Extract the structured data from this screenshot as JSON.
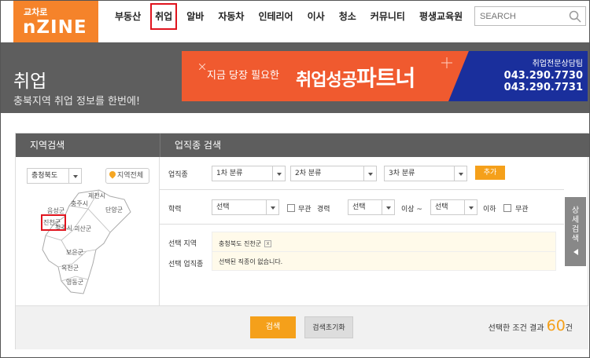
{
  "header": {
    "logo_small": "교차로",
    "logo_big": "nZINE",
    "nav": [
      "부동산",
      "취업",
      "알바",
      "자동차",
      "인테리어",
      "이사",
      "청소",
      "커뮤니티",
      "평생교육원"
    ],
    "active_nav": "취업",
    "search_placeholder": "SEARCH"
  },
  "banner": {
    "title": "취업",
    "subtitle": "충북지역 취업 정보를 한번에!",
    "promo_left": "지금 당장 필요한",
    "promo_main_prefix": "취업성공",
    "promo_main_big": "파트너",
    "promo_consult": "취업전문상담팀",
    "promo_phone1": "043.290.7730",
    "promo_phone2": "043.290.7731"
  },
  "region": {
    "header": "지역검색",
    "province": "충청북도",
    "all_button": "지역전체",
    "map_labels": [
      "제천시",
      "충주시",
      "음성군",
      "단양군",
      "진천군",
      "청주시",
      "괴산군",
      "보은군",
      "옥천군",
      "영동군"
    ]
  },
  "job": {
    "header": "업직종 검색",
    "category_label": "업직종",
    "cat1": "1차 분류",
    "cat2": "2차 분류",
    "cat3": "3차 분류",
    "add_button": "추가",
    "edu_label": "학력",
    "edu_value": "선택",
    "edu_none": "무관",
    "career_label": "경력",
    "career_from": "선택",
    "above": "이상 ~",
    "career_to": "선택",
    "below": "이하",
    "career_none": "무관",
    "sel_region_label": "선택 지역",
    "sel_region_value": "충청북도 진천군",
    "sel_job_label": "선택 업직종",
    "sel_job_value": "선택된 직종이 없습니다."
  },
  "detail_button": "상세검색",
  "bottom": {
    "search_button": "검색",
    "reset_button": "검색초기화",
    "result_prefix": "선택한 조건 결과",
    "result_count": "60",
    "result_suffix": "건"
  },
  "colors": {
    "accent": "#f5a01a",
    "logo": "#f5832a",
    "banner_bg": "#5e5e5e",
    "promo_red": "#f05a2f",
    "promo_blue": "#1a2f9c",
    "highlight": "#e0141e"
  }
}
